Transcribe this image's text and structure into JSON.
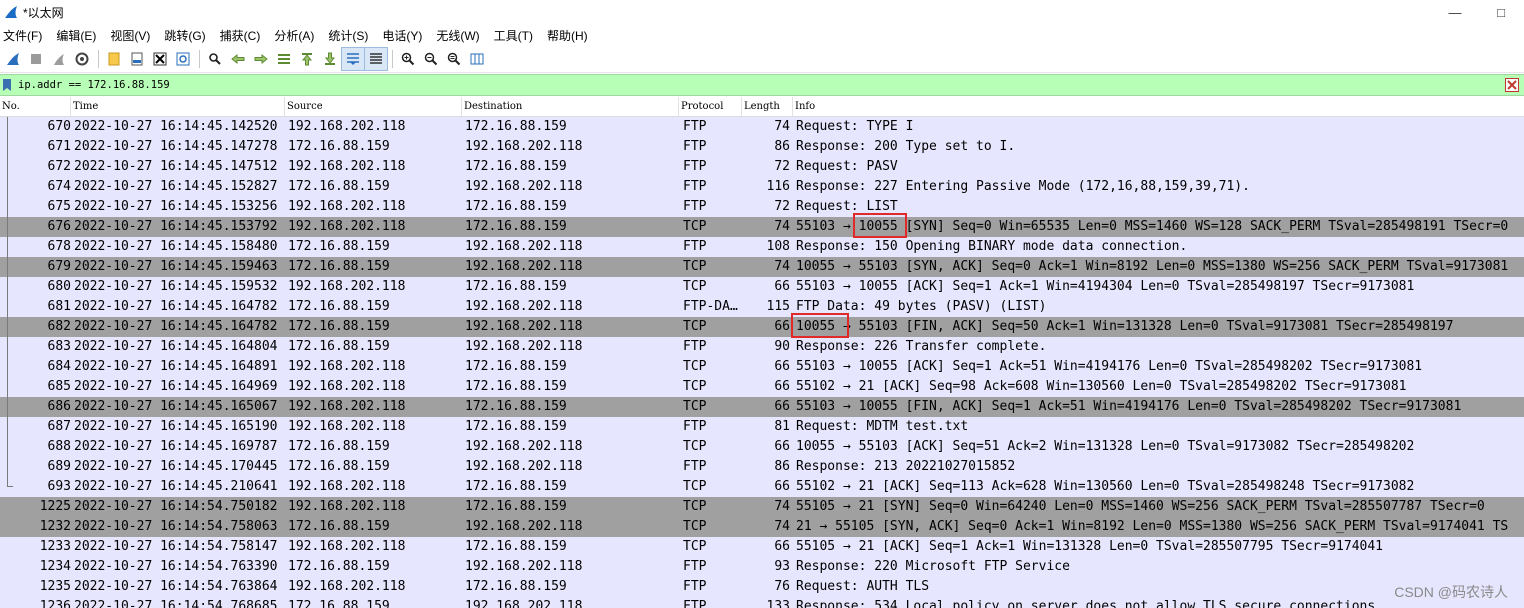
{
  "window": {
    "title": "*以太网"
  },
  "menu": [
    {
      "label": "文件(F)"
    },
    {
      "label": "编辑(E)"
    },
    {
      "label": "视图(V)"
    },
    {
      "label": "跳转(G)"
    },
    {
      "label": "捕获(C)"
    },
    {
      "label": "分析(A)"
    },
    {
      "label": "统计(S)"
    },
    {
      "label": "电话(Y)"
    },
    {
      "label": "无线(W)"
    },
    {
      "label": "工具(T)"
    },
    {
      "label": "帮助(H)"
    }
  ],
  "filter": {
    "value": "ip.addr == 172.16.88.159"
  },
  "columns": {
    "no": "No.",
    "time": "Time",
    "source": "Source",
    "destination": "Destination",
    "protocol": "Protocol",
    "length": "Length",
    "info": "Info"
  },
  "packets": [
    {
      "no": "670",
      "time": "2022-10-27 16:14:45.142520",
      "src": "192.168.202.118",
      "dst": "172.16.88.159",
      "proto": "FTP",
      "len": "74",
      "info": "Request: TYPE I",
      "shade": "light"
    },
    {
      "no": "671",
      "time": "2022-10-27 16:14:45.147278",
      "src": "172.16.88.159",
      "dst": "192.168.202.118",
      "proto": "FTP",
      "len": "86",
      "info": "Response: 200 Type set to I.",
      "shade": "light"
    },
    {
      "no": "672",
      "time": "2022-10-27 16:14:45.147512",
      "src": "192.168.202.118",
      "dst": "172.16.88.159",
      "proto": "FTP",
      "len": "72",
      "info": "Request: PASV",
      "shade": "light"
    },
    {
      "no": "674",
      "time": "2022-10-27 16:14:45.152827",
      "src": "172.16.88.159",
      "dst": "192.168.202.118",
      "proto": "FTP",
      "len": "116",
      "info": "Response: 227 Entering Passive Mode (172,16,88,159,39,71).",
      "shade": "light"
    },
    {
      "no": "675",
      "time": "2022-10-27 16:14:45.153256",
      "src": "192.168.202.118",
      "dst": "172.16.88.159",
      "proto": "FTP",
      "len": "72",
      "info": "Request: LIST",
      "shade": "light"
    },
    {
      "no": "676",
      "time": "2022-10-27 16:14:45.153792",
      "src": "192.168.202.118",
      "dst": "172.16.88.159",
      "proto": "TCP",
      "len": "74",
      "info": "55103 → 10055 [SYN] Seq=0 Win=65535 Len=0 MSS=1460 WS=128 SACK_PERM TSval=285498191 TSecr=0",
      "shade": "dark"
    },
    {
      "no": "678",
      "time": "2022-10-27 16:14:45.158480",
      "src": "172.16.88.159",
      "dst": "192.168.202.118",
      "proto": "FTP",
      "len": "108",
      "info": "Response: 150 Opening BINARY mode data connection.",
      "shade": "light"
    },
    {
      "no": "679",
      "time": "2022-10-27 16:14:45.159463",
      "src": "172.16.88.159",
      "dst": "192.168.202.118",
      "proto": "TCP",
      "len": "74",
      "info": "10055 → 55103 [SYN, ACK] Seq=0 Ack=1 Win=8192 Len=0 MSS=1380 WS=256 SACK_PERM TSval=9173081",
      "shade": "dark"
    },
    {
      "no": "680",
      "time": "2022-10-27 16:14:45.159532",
      "src": "192.168.202.118",
      "dst": "172.16.88.159",
      "proto": "TCP",
      "len": "66",
      "info": "55103 → 10055 [ACK] Seq=1 Ack=1 Win=4194304 Len=0 TSval=285498197 TSecr=9173081",
      "shade": "light"
    },
    {
      "no": "681",
      "time": "2022-10-27 16:14:45.164782",
      "src": "172.16.88.159",
      "dst": "192.168.202.118",
      "proto": "FTP-DA…",
      "len": "115",
      "info": "FTP Data: 49 bytes (PASV) (LIST)",
      "shade": "light"
    },
    {
      "no": "682",
      "time": "2022-10-27 16:14:45.164782",
      "src": "172.16.88.159",
      "dst": "192.168.202.118",
      "proto": "TCP",
      "len": "66",
      "info": "10055 → 55103 [FIN, ACK] Seq=50 Ack=1 Win=131328 Len=0 TSval=9173081 TSecr=285498197",
      "shade": "dark"
    },
    {
      "no": "683",
      "time": "2022-10-27 16:14:45.164804",
      "src": "172.16.88.159",
      "dst": "192.168.202.118",
      "proto": "FTP",
      "len": "90",
      "info": "Response: 226 Transfer complete.",
      "shade": "light"
    },
    {
      "no": "684",
      "time": "2022-10-27 16:14:45.164891",
      "src": "192.168.202.118",
      "dst": "172.16.88.159",
      "proto": "TCP",
      "len": "66",
      "info": "55103 → 10055 [ACK] Seq=1 Ack=51 Win=4194176 Len=0 TSval=285498202 TSecr=9173081",
      "shade": "light"
    },
    {
      "no": "685",
      "time": "2022-10-27 16:14:45.164969",
      "src": "192.168.202.118",
      "dst": "172.16.88.159",
      "proto": "TCP",
      "len": "66",
      "info": "55102 → 21 [ACK] Seq=98 Ack=608 Win=130560 Len=0 TSval=285498202 TSecr=9173081",
      "shade": "light"
    },
    {
      "no": "686",
      "time": "2022-10-27 16:14:45.165067",
      "src": "192.168.202.118",
      "dst": "172.16.88.159",
      "proto": "TCP",
      "len": "66",
      "info": "55103 → 10055 [FIN, ACK] Seq=1 Ack=51 Win=4194176 Len=0 TSval=285498202 TSecr=9173081",
      "shade": "dark"
    },
    {
      "no": "687",
      "time": "2022-10-27 16:14:45.165190",
      "src": "192.168.202.118",
      "dst": "172.16.88.159",
      "proto": "FTP",
      "len": "81",
      "info": "Request: MDTM test.txt",
      "shade": "light"
    },
    {
      "no": "688",
      "time": "2022-10-27 16:14:45.169787",
      "src": "172.16.88.159",
      "dst": "192.168.202.118",
      "proto": "TCP",
      "len": "66",
      "info": "10055 → 55103 [ACK] Seq=51 Ack=2 Win=131328 Len=0 TSval=9173082 TSecr=285498202",
      "shade": "light"
    },
    {
      "no": "689",
      "time": "2022-10-27 16:14:45.170445",
      "src": "172.16.88.159",
      "dst": "192.168.202.118",
      "proto": "FTP",
      "len": "86",
      "info": "Response: 213 20221027015852",
      "shade": "light"
    },
    {
      "no": "693",
      "time": "2022-10-27 16:14:45.210641",
      "src": "192.168.202.118",
      "dst": "172.16.88.159",
      "proto": "TCP",
      "len": "66",
      "info": "55102 → 21 [ACK] Seq=113 Ack=628 Win=130560 Len=0 TSval=285498248 TSecr=9173082",
      "shade": "light"
    },
    {
      "no": "1225",
      "time": "2022-10-27 16:14:54.750182",
      "src": "192.168.202.118",
      "dst": "172.16.88.159",
      "proto": "TCP",
      "len": "74",
      "info": "55105 → 21 [SYN] Seq=0 Win=64240 Len=0 MSS=1460 WS=256 SACK_PERM TSval=285507787 TSecr=0",
      "shade": "dark"
    },
    {
      "no": "1232",
      "time": "2022-10-27 16:14:54.758063",
      "src": "172.16.88.159",
      "dst": "192.168.202.118",
      "proto": "TCP",
      "len": "74",
      "info": "21 → 55105 [SYN, ACK] Seq=0 Ack=1 Win=8192 Len=0 MSS=1380 WS=256 SACK_PERM TSval=9174041 TS",
      "shade": "dark"
    },
    {
      "no": "1233",
      "time": "2022-10-27 16:14:54.758147",
      "src": "192.168.202.118",
      "dst": "172.16.88.159",
      "proto": "TCP",
      "len": "66",
      "info": "55105 → 21 [ACK] Seq=1 Ack=1 Win=131328 Len=0 TSval=285507795 TSecr=9174041",
      "shade": "light"
    },
    {
      "no": "1234",
      "time": "2022-10-27 16:14:54.763390",
      "src": "172.16.88.159",
      "dst": "192.168.202.118",
      "proto": "FTP",
      "len": "93",
      "info": "Response: 220 Microsoft FTP Service",
      "shade": "light"
    },
    {
      "no": "1235",
      "time": "2022-10-27 16:14:54.763864",
      "src": "192.168.202.118",
      "dst": "172.16.88.159",
      "proto": "FTP",
      "len": "76",
      "info": "Request: AUTH TLS",
      "shade": "light"
    },
    {
      "no": "1236",
      "time": "2022-10-27 16:14:54.768685",
      "src": "172.16.88.159",
      "dst": "192.168.202.118",
      "proto": "FTP",
      "len": "133",
      "info": "Response: 534 Local policy on server does not allow TLS secure connections.",
      "shade": "light"
    }
  ],
  "watermark": "CSDN @码农诗人"
}
